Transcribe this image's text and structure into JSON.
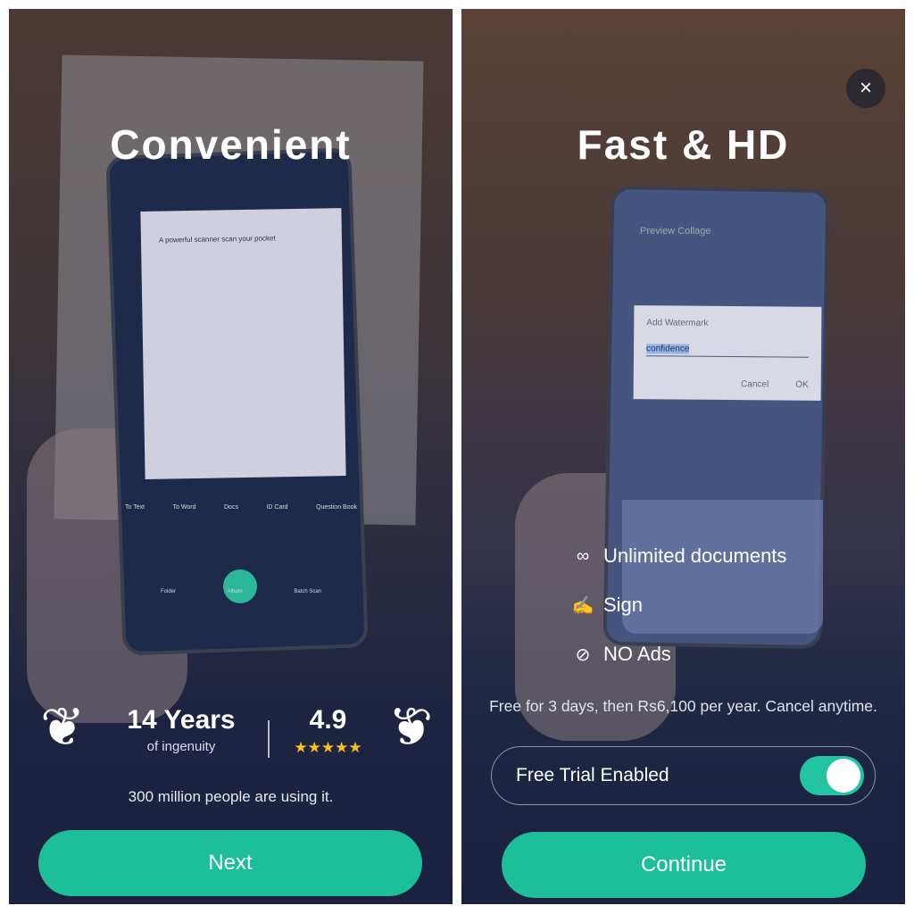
{
  "left": {
    "title": "Convenient",
    "phone_screen": {
      "doc_heading": "A powerful scanner scan your pocket",
      "tabs": [
        "To Text",
        "To Word",
        "Docs",
        "ID Card",
        "Question Book"
      ],
      "tools": [
        "Folder",
        "Album",
        "Batch Scan"
      ]
    },
    "stats": {
      "years": "14 Years",
      "years_sub": "of ingenuity",
      "rating": "4.9",
      "stars": "★★★★★",
      "star_count": 5
    },
    "users_text": "300 million people are using it.",
    "next_label": "Next"
  },
  "right": {
    "close_icon": "×",
    "title": "Fast & HD",
    "phone_screen": {
      "header": "Preview Collage",
      "dialog_title": "Add Watermark",
      "dialog_value": "confidence",
      "cancel": "Cancel",
      "ok": "OK"
    },
    "features": [
      {
        "icon": "infinity-icon",
        "glyph": "∞",
        "label": "Unlimited documents"
      },
      {
        "icon": "signature-icon",
        "glyph": "✍",
        "label": "Sign"
      },
      {
        "icon": "no-ads-icon",
        "glyph": "⊘",
        "label": "NO Ads"
      }
    ],
    "terms": "Free for 3 days, then Rs6,100 per year. Cancel anytime.",
    "trial_label": "Free Trial Enabled",
    "trial_enabled": true,
    "continue_label": "Continue"
  },
  "colors": {
    "accent": "#1dbf9a",
    "toggle": "#22c4a3",
    "star": "#f5c21b",
    "background": "#1b2240"
  }
}
